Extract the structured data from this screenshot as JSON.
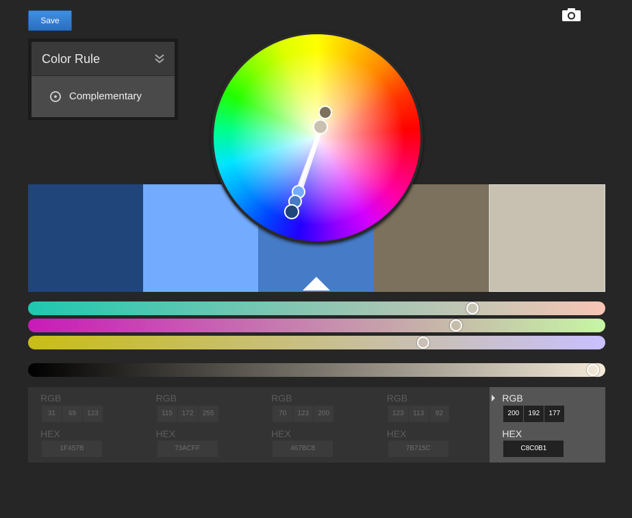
{
  "toolbar": {
    "save_label": "Save",
    "camera_icon": "camera-icon"
  },
  "rule": {
    "title": "Color Rule",
    "selected": "Complementary"
  },
  "swatches": [
    {
      "hex": "#1F457B",
      "rgb": [
        "31",
        "69",
        "123"
      ],
      "hex_text": "1F457B"
    },
    {
      "hex": "#73ACFF",
      "rgb": [
        "115",
        "172",
        "255"
      ],
      "hex_text": "73ACFF"
    },
    {
      "hex": "#467BC8",
      "rgb": [
        "70",
        "123",
        "200"
      ],
      "hex_text": "467BC8"
    },
    {
      "hex": "#7B715C",
      "rgb": [
        "123",
        "113",
        "92"
      ],
      "hex_text": "7B715C"
    },
    {
      "hex": "#C8C0B1",
      "rgb": [
        "200",
        "192",
        "177"
      ],
      "hex_text": "C8C0B1"
    }
  ],
  "selected_swatch": 4,
  "base_swatch": 2,
  "labels": {
    "rgb": "RGB",
    "hex": "HEX"
  },
  "sliders": [
    {
      "from": "#1ec8b0",
      "to": "#f8c5b5",
      "value": 0.776
    },
    {
      "from": "#c81ab8",
      "to": "#c6f6a4",
      "value": 0.747
    },
    {
      "from": "#c8be14",
      "to": "#c9c0ff",
      "value": 0.689
    }
  ],
  "brightness": {
    "from": "#000000",
    "to": "#f4ead8",
    "value": 0.989
  },
  "colors": {
    "save": "#2f7fd3",
    "panel": "#333333",
    "active_panel": "#555555"
  }
}
